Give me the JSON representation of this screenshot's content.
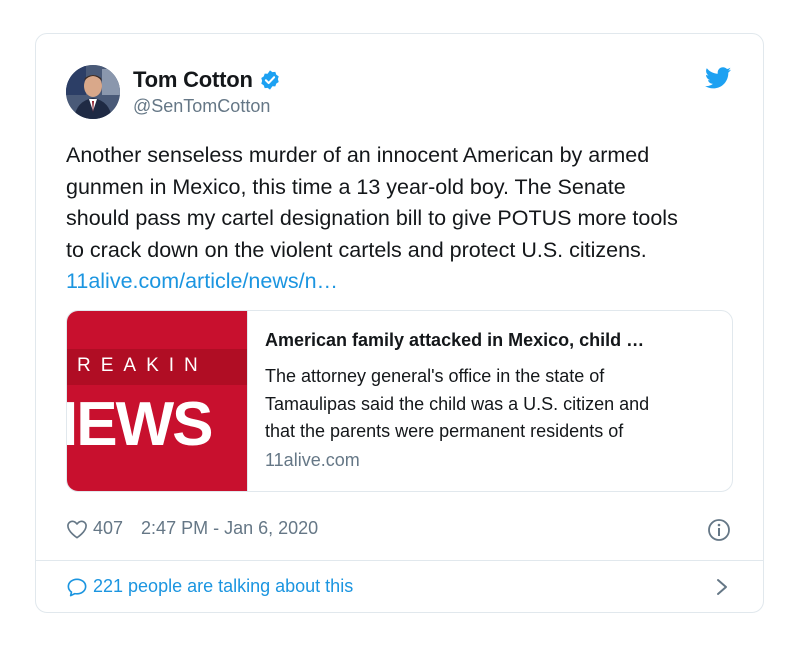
{
  "author": {
    "display_name": "Tom Cotton",
    "handle": "@SenTomCotton",
    "avatar_icon": "profile-photo",
    "verified_icon": "verified-badge-icon"
  },
  "tweet": {
    "text_lines": [
      "Another senseless murder of an innocent American by armed",
      "gunmen in Mexico, this time a 13 year-old boy. The Senate",
      "should pass my cartel designation bill to give POTUS more tools",
      "to crack down on the violent cartels and protect U.S. citizens."
    ],
    "link": "11alive.com/article/news/n…"
  },
  "link_card": {
    "thumbnail_text": [
      "REAKIN",
      "IEWS"
    ],
    "title": "American family attacked in Mexico, child …",
    "description_lines": [
      "The attorney general's office in the state of",
      "Tamaulipas said the child was a U.S. citizen and",
      "that the parents were permanent residents of"
    ],
    "domain": "11alive.com"
  },
  "meta": {
    "likes": "407",
    "timestamp": "2:47 PM - Jan 6, 2020"
  },
  "footer": {
    "talking": "221 people are talking about this"
  },
  "colors": {
    "accent": "#1b95e0",
    "muted": "#657786",
    "border": "#e1e8ed",
    "thumbnail_red": "#c8102e"
  }
}
